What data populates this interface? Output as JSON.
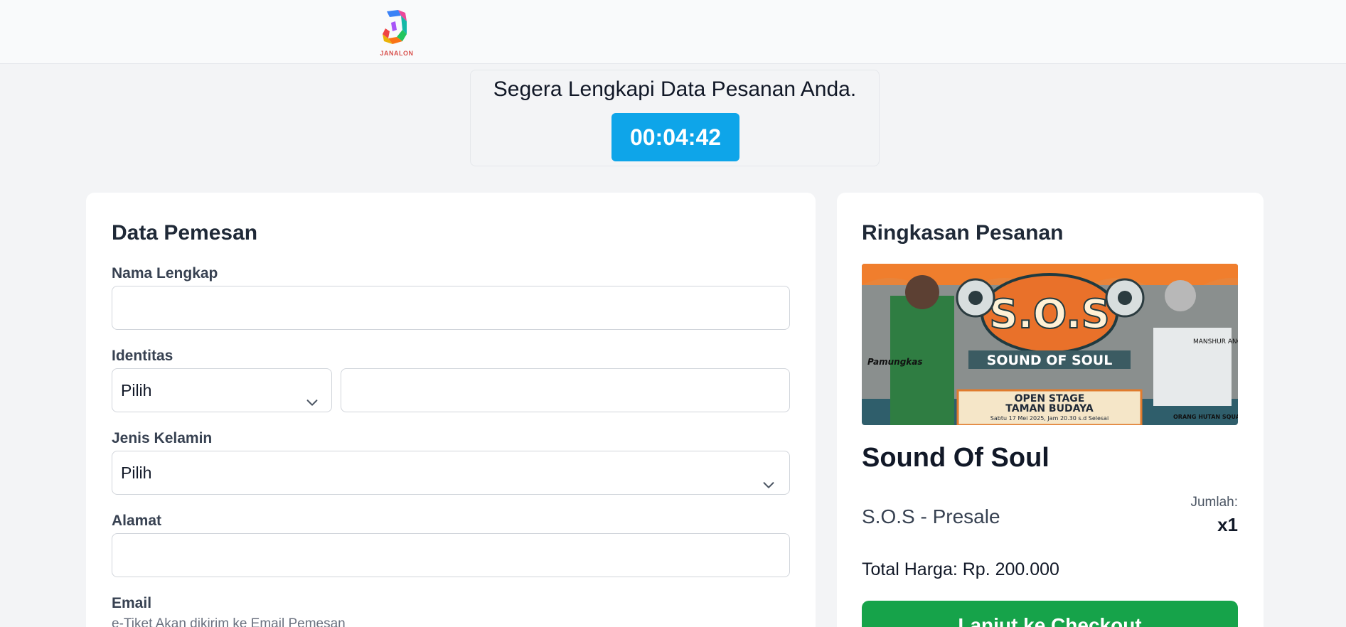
{
  "brand": {
    "logo_text": "JANALON"
  },
  "timer": {
    "title": "Segera Lengkapi Data Pesanan Anda.",
    "countdown": "00:04:42"
  },
  "form": {
    "title": "Data Pemesan",
    "fields": {
      "full_name": {
        "label": "Nama Lengkap",
        "value": ""
      },
      "identity": {
        "label": "Identitas",
        "type_selected": "Pilih",
        "number_value": ""
      },
      "gender": {
        "label": "Jenis Kelamin",
        "selected": "Pilih"
      },
      "address": {
        "label": "Alamat",
        "value": ""
      },
      "email": {
        "label": "Email",
        "hint": "e-Tiket Akan dikirim ke Email Pemesan"
      }
    }
  },
  "summary": {
    "title": "Ringkasan Pesanan",
    "banner": {
      "headline": "S.O.S",
      "subtitle": "SOUND OF SOUL",
      "line1": "OPEN STAGE",
      "line2": "TAMAN BUDAYA",
      "date_line": "Sabtu 17 Mei 2025, Jam 20.30 s.d Selesai",
      "artist_left": "Pamungkas",
      "artist_right": "MANSHUR ANGKLONG",
      "artist_bottom": "ORANG HUTAN SQUAD"
    },
    "event_name": "Sound Of Soul",
    "ticket_name": "S.O.S - Presale",
    "quantity_label": "Jumlah:",
    "quantity_value": "x1",
    "total": "Total Harga: Rp. 200.000",
    "checkout_label": "Lanjut ke Checkout"
  },
  "colors": {
    "timer_bg": "#0ea5e9",
    "checkout_bg": "#16a34a",
    "page_bg": "#f3f4f6"
  }
}
